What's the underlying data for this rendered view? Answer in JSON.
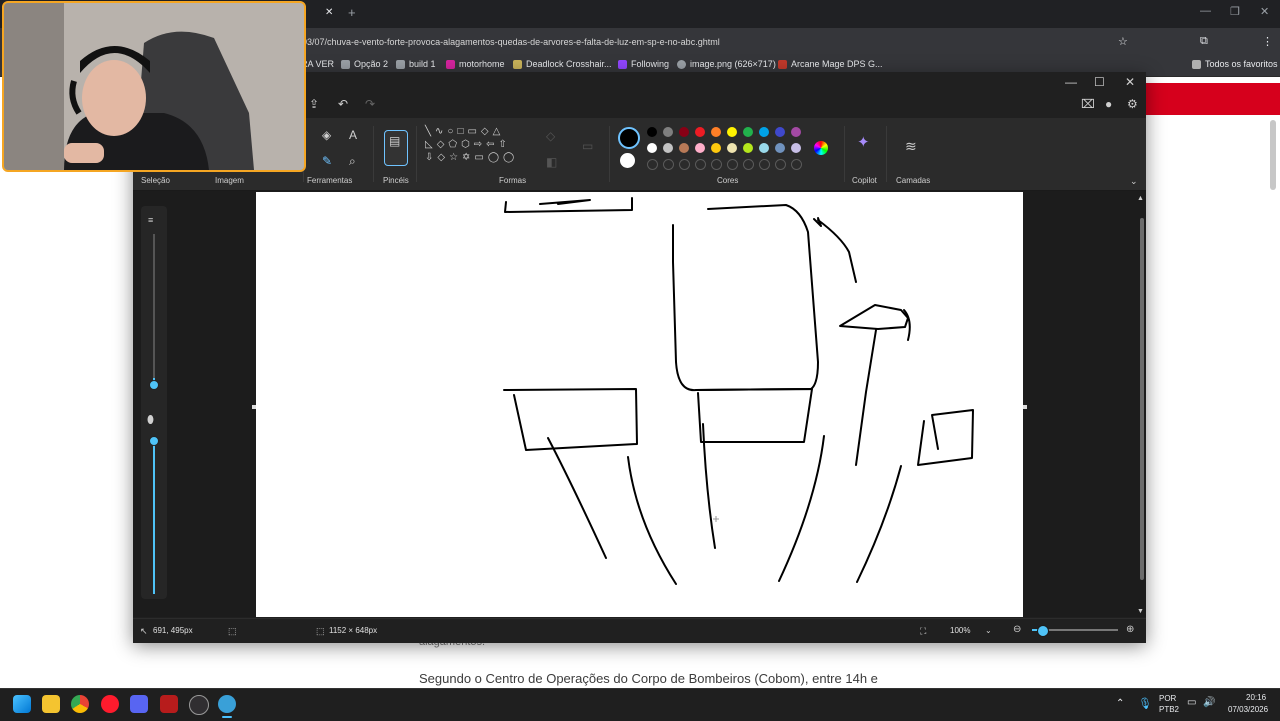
{
  "browser": {
    "url": "03/07/chuva-e-vento-forte-provoca-alagamentos-quedas-de-arvores-e-falta-de-luz-em-sp-e-no-abc.ghtml",
    "tab_close": "✕",
    "tab_new": "+",
    "bookmarks": [
      "RA VER",
      "Opção 2",
      "build 1",
      "motorhome",
      "Deadlock Crosshair...",
      "Following",
      "image.png (626×717)",
      "Arcane Mage DPS G..."
    ],
    "all_bookmarks": "Todos os favoritos",
    "accent": "#d6001c"
  },
  "article": {
    "fragment": "alagamentos.",
    "paragraph": "Segundo o Centro de Operações do Corpo de Bombeiros (Cobom), entre 14h e"
  },
  "paint": {
    "ribbon": {
      "groups": [
        "Seleção",
        "Imagem",
        "Ferramentas",
        "Pincéis",
        "Formas",
        "Cores",
        "Copilot",
        "Camadas"
      ]
    },
    "colors": {
      "row1": [
        "#000000",
        "#7f7f7f",
        "#880015",
        "#ed1c24",
        "#ff7f27",
        "#fff200",
        "#22b14c",
        "#00a2e8",
        "#3f48cc",
        "#a349a4"
      ],
      "row2": [
        "#ffffff",
        "#c3c3c3",
        "#b97a57",
        "#ffaec9",
        "#ffc90e",
        "#efe4b0",
        "#b5e61d",
        "#99d9ea",
        "#7092be",
        "#c8bfe7"
      ],
      "primary": "#000000",
      "secondary": "#ffffff"
    },
    "status": {
      "cursor_pos": "691, 495px",
      "canvas_size": "1152 × 648px",
      "zoom": "100%",
      "zoom_fraction": 0.12
    }
  },
  "taskbar": {
    "lang": "POR",
    "layout": "PTB2",
    "time": "20:16",
    "date": "07/03/2026"
  }
}
